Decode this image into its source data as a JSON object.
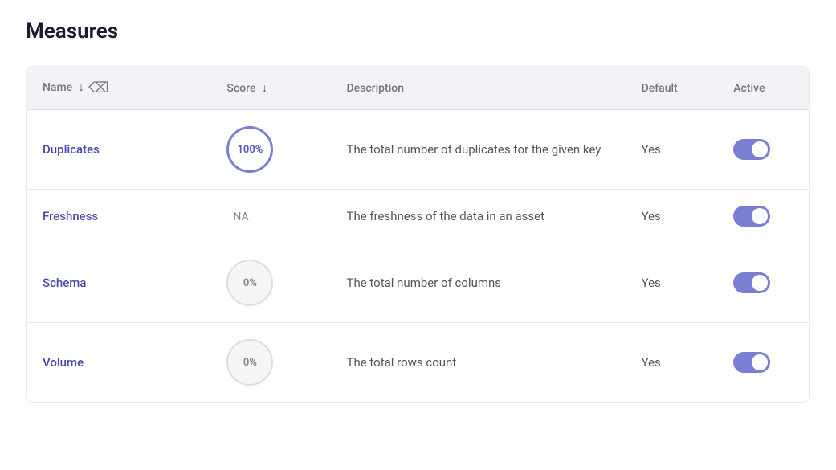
{
  "page": {
    "title": "Measures"
  },
  "table": {
    "columns": [
      {
        "id": "name",
        "label": "Name",
        "sortable": true
      },
      {
        "id": "score",
        "label": "Score",
        "sortable": true
      },
      {
        "id": "description",
        "label": "Description",
        "sortable": false
      },
      {
        "id": "default",
        "label": "Default",
        "sortable": false
      },
      {
        "id": "active",
        "label": "Active",
        "sortable": false
      }
    ],
    "rows": [
      {
        "name": "Duplicates",
        "score_type": "circle_full",
        "score_value": "100%",
        "description": "The total number of duplicates for the given key",
        "default": "Yes",
        "active": true
      },
      {
        "name": "Freshness",
        "score_type": "na",
        "score_value": "NA",
        "description": "The freshness of the data in an asset",
        "default": "Yes",
        "active": true
      },
      {
        "name": "Schema",
        "score_type": "circle_zero",
        "score_value": "0%",
        "description": "The total number of columns",
        "default": "Yes",
        "active": true
      },
      {
        "name": "Volume",
        "score_type": "circle_zero",
        "score_value": "0%",
        "description": "The total rows count",
        "default": "Yes",
        "active": true
      }
    ]
  }
}
